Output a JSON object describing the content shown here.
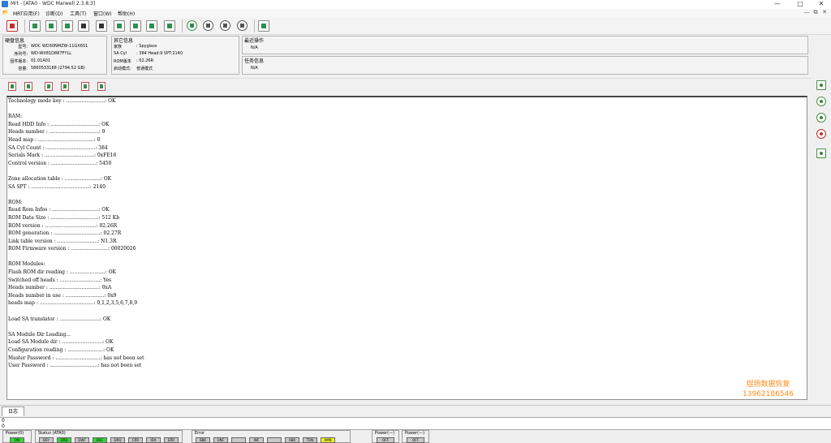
{
  "window": {
    "title": "Mrt - [ATA0 - WDC Marwell 2.3.8.3]",
    "min": "—",
    "max": "□",
    "close": "✕"
  },
  "menu": {
    "items": [
      "MRT应用(F)",
      "诊断(D)",
      "工具(T)",
      "窗口(W)",
      "帮助(H)"
    ],
    "mdi": [
      "—",
      "⧉",
      "✕"
    ]
  },
  "disk_info": {
    "header": "硬盘信息",
    "rows": [
      {
        "label": "型号:",
        "value": "WDC WD30NMZW-11GX6S1"
      },
      {
        "label": "序列号:",
        "value": "WD-WX81D887FYLL"
      },
      {
        "label": "固件版本:",
        "value": "01.01A01"
      },
      {
        "label": "容量:",
        "value": "5860533168 (2794.52 GB)"
      }
    ]
  },
  "other_info": {
    "header": "其它信息",
    "rows": [
      {
        "label": "家族",
        "value": ": Spyglass"
      },
      {
        "label": "SA Cyl",
        "value": ": 384   Head:9   SPT:2140"
      },
      {
        "label": "ROM版本",
        "value": ": 02.26R"
      },
      {
        "label": "启动模式:",
        "value": "普通模式"
      }
    ]
  },
  "recent_op": {
    "header": "最近操作",
    "value": "N/A"
  },
  "task_info": {
    "header": "任务信息",
    "value": "N/A"
  },
  "log_lines": [
    "Technology mode key : .........................: OK",
    "",
    "RAM:",
    "Read HDD Info : ...............................: OK",
    "Heads number : ................................: 9",
    "Head map : ....................................: 0",
    "SA Cyl Count : ................................: 384",
    "Serials Mark : ................................: 0xFE16",
    "Control version : .............................: 5450",
    "",
    "Zone allocation table : .......................: OK",
    "SA SPT : ......................................: 2140",
    "",
    "ROM:",
    "Read Rom Infos : ..............................: OK",
    "ROM Data Size : ...............................: 512 Kb",
    "ROM version : .................................: 02.26R",
    "ROM generation : ..............................: 02.27R",
    "Link table version : ..........................: N1.3R",
    "ROM Firmware version : ........................: 00020026",
    "",
    "ROM Modules:",
    "Flash ROM dir reading : .......................: OK",
    "Switched off heads : ..........................: Yes",
    "Heads number : ................................: 0xA",
    "Heads number in use : .........................: 0x9",
    "heads map : ...................................: 0,1,2,3,5,6,7,8,9",
    "",
    "Load SA translator : ..........................: OK",
    "",
    "SA Module Dir Loading...",
    "Load SA Module dir : ..........................: OK",
    "Configuration reading : .......................: OK",
    "Master Password : .............................: has not been set",
    "User Password : ...............................: has not been set"
  ],
  "watermark": {
    "line1": "煜扬数据恢复",
    "line2": "13962186546"
  },
  "tabs": {
    "log": "日志"
  },
  "scroll_rows": [
    "0",
    "0"
  ],
  "status": {
    "power0": {
      "label": "Power(0)",
      "value": "ON"
    },
    "status_group": {
      "label": "Status (ATA0)",
      "items": [
        "BSY",
        "DRD",
        "DWF",
        "DSC",
        "DRQ",
        "CRR",
        "IDX",
        "ERR"
      ],
      "on": [
        false,
        true,
        false,
        true,
        false,
        false,
        false,
        false
      ]
    },
    "error_group": {
      "label": "Error",
      "items": [
        "BBK",
        "UNC",
        "",
        "INF",
        "",
        "ABR",
        "TON",
        "AMN"
      ],
      "warn": [
        false,
        false,
        false,
        false,
        false,
        false,
        false,
        true
      ]
    },
    "power1": {
      "label": "Power(—)",
      "value": "OFF"
    },
    "power2": {
      "label": "Power(—)",
      "value": "OFF"
    }
  },
  "colors": {
    "accent_green": "#3ad33a",
    "warn_yellow": "#f2f22a",
    "watermark": "#ff8c1a"
  }
}
